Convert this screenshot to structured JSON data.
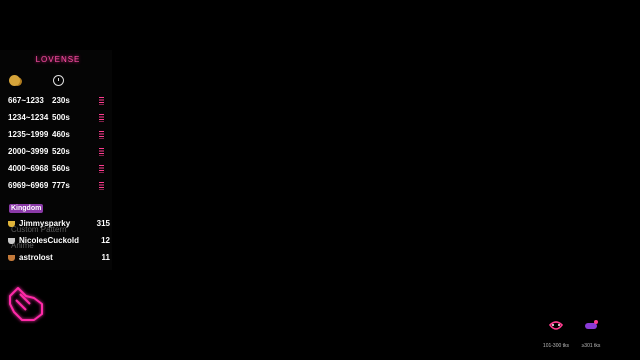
{
  "brand": "LOVENSE",
  "levels_header": {
    "coins_icon": "coins-icon",
    "time_icon": "clock-icon"
  },
  "levels": [
    {
      "range": "667~1233",
      "duration": "230s"
    },
    {
      "range": "1234~1234",
      "duration": "500s"
    },
    {
      "range": "1235~1999",
      "duration": "460s"
    },
    {
      "range": "2000~3999",
      "duration": "520s"
    },
    {
      "range": "4000~6968",
      "duration": "560s"
    },
    {
      "range": "6969~6969",
      "duration": "777s"
    }
  ],
  "leaderboard": {
    "title": "Kingdom",
    "entries": [
      {
        "name": "Jimmysparky",
        "points": "315",
        "medal_color": "#e0b43a"
      },
      {
        "name": "NicolesCuckold",
        "points": "12",
        "medal_color": "#c9c9c9"
      },
      {
        "name": "astrolost",
        "points": "11",
        "medal_color": "#c47a3a"
      }
    ]
  },
  "ghost_text": [
    "Custom Pattern",
    "Anime"
  ],
  "bottom_right": [
    {
      "label": "101-300 tks"
    },
    {
      "label": "≥301 tks"
    }
  ],
  "colors": {
    "accent": "#ff3b8f",
    "neon": "#ff2aa8"
  }
}
